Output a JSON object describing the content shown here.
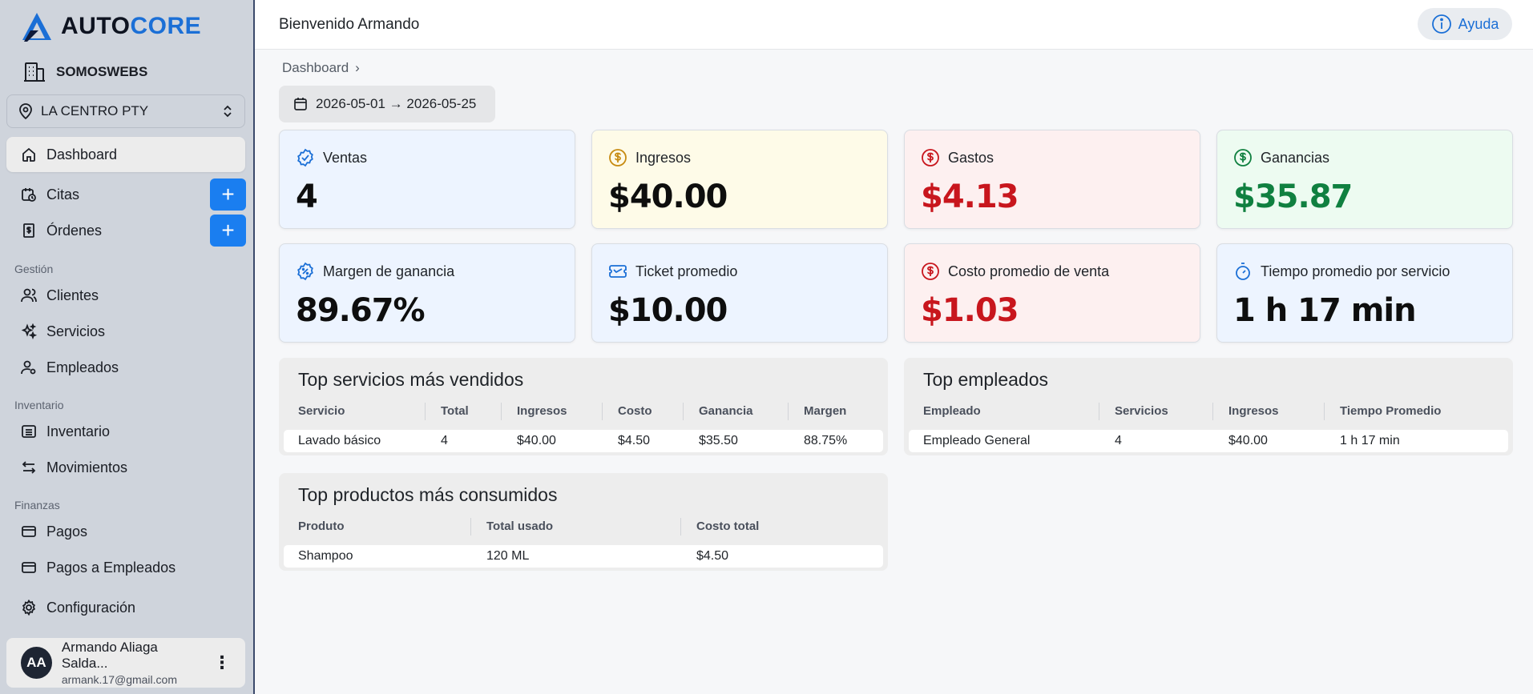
{
  "brand": {
    "part1": "AUTO",
    "part2": "CORE"
  },
  "org": "SOMOSWEBS",
  "location": "LA CENTRO PTY",
  "nav": {
    "dashboard": "Dashboard",
    "citas": "Citas",
    "ordenes": "Órdenes",
    "section_gestion": "Gestión",
    "clientes": "Clientes",
    "servicios": "Servicios",
    "empleados": "Empleados",
    "section_inventario": "Inventario",
    "inventario": "Inventario",
    "movimientos": "Movimientos",
    "section_finanzas": "Finanzas",
    "pagos": "Pagos",
    "pagos_empleados": "Pagos a Empleados",
    "configuracion": "Configuración",
    "plus": "+"
  },
  "user": {
    "initials": "AA",
    "name": "Armando Aliaga Salda...",
    "email": "armank.17@gmail.com",
    "menu": "⋮"
  },
  "topbar": {
    "welcome": "Bienvenido Armando",
    "help": "Ayuda"
  },
  "breadcrumb": {
    "label": "Dashboard",
    "sep": "›"
  },
  "date_range": "2026-05-01 → 2026-05-25",
  "kpis": {
    "ventas": {
      "label": "Ventas",
      "value": "4"
    },
    "ingresos": {
      "label": "Ingresos",
      "value": "$40.00"
    },
    "gastos": {
      "label": "Gastos",
      "value": "$4.13"
    },
    "ganancias": {
      "label": "Ganancias",
      "value": "$35.87"
    },
    "margen": {
      "label": "Margen de ganancia",
      "value": "89.67%"
    },
    "ticket": {
      "label": "Ticket promedio",
      "value": "$10.00"
    },
    "costo": {
      "label": "Costo promedio de venta",
      "value": "$1.03"
    },
    "tiempo": {
      "label": "Tiempo promedio por servicio",
      "value": "1 h 17 min"
    }
  },
  "top_servicios": {
    "title": "Top servicios más vendidos",
    "headers": [
      "Servicio",
      "Total",
      "Ingresos",
      "Costo",
      "Ganancia",
      "Margen"
    ],
    "rows": [
      [
        "Lavado básico",
        "4",
        "$40.00",
        "$4.50",
        "$35.50",
        "88.75%"
      ]
    ]
  },
  "top_empleados": {
    "title": "Top empleados",
    "headers": [
      "Empleado",
      "Servicios",
      "Ingresos",
      "Tiempo Promedio"
    ],
    "rows": [
      [
        "Empleado General",
        "4",
        "$40.00",
        "1 h 17 min"
      ]
    ]
  },
  "top_productos": {
    "title": "Top productos más consumidos",
    "headers": [
      "Produto",
      "Total usado",
      "Costo total"
    ],
    "rows": [
      [
        "Shampoo",
        "120 ML",
        "$4.50"
      ]
    ]
  },
  "colors": {
    "accent": "#1b6fd6",
    "red": "#c8161d",
    "green": "#108040",
    "plus_button": "#1a7ef0"
  }
}
